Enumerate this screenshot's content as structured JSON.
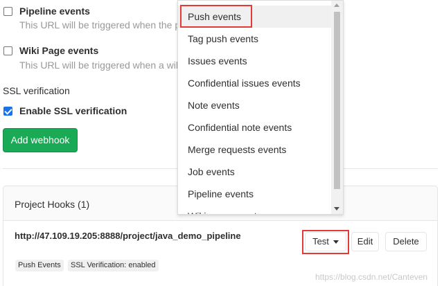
{
  "events": [
    {
      "label": "Pipeline events",
      "help": "This URL will be triggered when the p",
      "checked": false
    },
    {
      "label": "Wiki Page events",
      "help": "This URL will be triggered when a wik",
      "checked": false
    }
  ],
  "ssl": {
    "section_title": "SSL verification",
    "enable_label": "Enable SSL verification",
    "checked": true
  },
  "add_webhook_label": "Add webhook",
  "project_hooks": {
    "title": "Project Hooks (1)",
    "hook": {
      "url": "http://47.109.19.205:8888/project/java_demo_pipeline",
      "badges": [
        "Push Events",
        "SSL Verification: enabled"
      ],
      "test_label": "Test",
      "edit_label": "Edit",
      "delete_label": "Delete"
    }
  },
  "test_dropdown": {
    "items": [
      "Push events",
      "Tag push events",
      "Issues events",
      "Confidential issues events",
      "Note events",
      "Confidential note events",
      "Merge requests events",
      "Job events",
      "Pipeline events",
      "Wiki page events"
    ],
    "highlighted": "Push events"
  },
  "colors": {
    "primary_green": "#1aaa55",
    "highlight_red": "#e53935",
    "checkbox_blue": "#1a73e8"
  },
  "watermark": "https://blog.csdn.net/Canteven"
}
